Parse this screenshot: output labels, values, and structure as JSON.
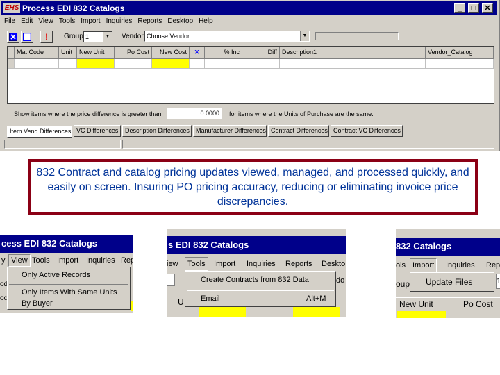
{
  "window": {
    "logo": "EHS",
    "title": "Process EDI 832 Catalogs",
    "controls": {
      "minimize": "_",
      "maximize": "□",
      "close": "✕"
    }
  },
  "menu": [
    "File",
    "Edit",
    "View",
    "Tools",
    "Import",
    "Inquiries",
    "Reports",
    "Desktop",
    "Help"
  ],
  "toolbar": {
    "alert_glyph": "!",
    "group_label": "Group",
    "group_value": "1",
    "vendor_label": "Vendor",
    "vendor_value": "Choose Vendor"
  },
  "grid": {
    "columns": [
      "Mat Code",
      "Unit",
      "New Unit",
      "Po Cost",
      "New Cost",
      "✕",
      "% Inc",
      "Diff",
      "Description1",
      "Vendor_Catalog"
    ]
  },
  "filter": {
    "prefix": "Show items where the price difference is greater than",
    "value": "0.0000",
    "suffix": "for items where the Units of Purchase are the same."
  },
  "tabs": [
    "Item Vend Differences",
    "VC Differences",
    "Description Differences",
    "Manufacturer Differences",
    "Contract Differences",
    "Contract VC Differences"
  ],
  "caption": "832 Contract and catalog pricing updates viewed, managed, and processed quickly, and easily on screen. Insuring PO pricing accuracy, reducing or eliminating invoice price discrepancies.",
  "zoom1": {
    "title": "cess EDI 832 Catalogs",
    "menu": [
      "y",
      "View",
      "Tools",
      "Import",
      "Inquiries",
      "Rep"
    ],
    "items": [
      "Only Active Records",
      "Only Items With Same Units",
      "By Buyer"
    ],
    "left_frags": [
      "od",
      "ocl"
    ]
  },
  "zoom2": {
    "title": "s EDI 832 Catalogs",
    "menu": [
      "iew",
      "Tools",
      "Import",
      "Inquiries",
      "Reports",
      "Deskto"
    ],
    "items": [
      {
        "label": "Create Contracts from 832 Data",
        "shortcut": ""
      },
      {
        "label": "Email",
        "shortcut": "Alt+M"
      }
    ],
    "left_frag": "U",
    "right_frag": "do"
  },
  "zoom3": {
    "title": "832 Catalogs",
    "menu": [
      "ols",
      "Import",
      "Inquiries",
      "Rep"
    ],
    "items": [
      "Update Files"
    ],
    "left_frag": "oup",
    "right_frag": "1",
    "columns": [
      "New Unit",
      "Po Cost"
    ]
  },
  "colors": {
    "title_bg": "#00008a",
    "face": "#d4d0c8",
    "highlight": "#ffff00",
    "caption_border": "#8b0015",
    "caption_text": "#003399"
  }
}
